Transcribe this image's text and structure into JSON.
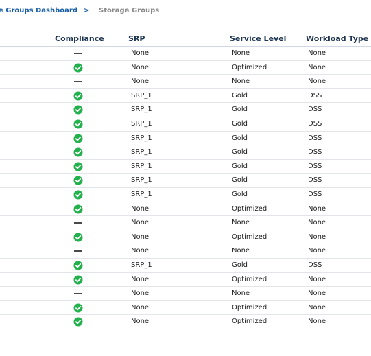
{
  "breadcrumb": {
    "parent_label": "Storage Groups Dashboard",
    "separator": ">",
    "current_label": "Storage Groups"
  },
  "table": {
    "headers": {
      "compliance": "Compliance",
      "srp": "SRP",
      "service_level": "Service Level",
      "workload_type": "Workload Type"
    },
    "rows": [
      {
        "compliance": "none",
        "srp": "None",
        "service_level": "None",
        "workload_type": "None"
      },
      {
        "compliance": "compliant",
        "srp": "None",
        "service_level": "Optimized",
        "workload_type": "None"
      },
      {
        "compliance": "none",
        "srp": "None",
        "service_level": "None",
        "workload_type": "None"
      },
      {
        "compliance": "compliant",
        "srp": "SRP_1",
        "service_level": "Gold",
        "workload_type": "DSS"
      },
      {
        "compliance": "compliant",
        "srp": "SRP_1",
        "service_level": "Gold",
        "workload_type": "DSS"
      },
      {
        "compliance": "compliant",
        "srp": "SRP_1",
        "service_level": "Gold",
        "workload_type": "DSS"
      },
      {
        "compliance": "compliant",
        "srp": "SRP_1",
        "service_level": "Gold",
        "workload_type": "DSS"
      },
      {
        "compliance": "compliant",
        "srp": "SRP_1",
        "service_level": "Gold",
        "workload_type": "DSS"
      },
      {
        "compliance": "compliant",
        "srp": "SRP_1",
        "service_level": "Gold",
        "workload_type": "DSS"
      },
      {
        "compliance": "compliant",
        "srp": "SRP_1",
        "service_level": "Gold",
        "workload_type": "DSS"
      },
      {
        "compliance": "compliant",
        "srp": "SRP_1",
        "service_level": "Gold",
        "workload_type": "DSS"
      },
      {
        "compliance": "compliant",
        "srp": "None",
        "service_level": "Optimized",
        "workload_type": "None"
      },
      {
        "compliance": "none",
        "srp": "None",
        "service_level": "None",
        "workload_type": "None"
      },
      {
        "compliance": "compliant",
        "srp": "None",
        "service_level": "Optimized",
        "workload_type": "None"
      },
      {
        "compliance": "none",
        "srp": "None",
        "service_level": "None",
        "workload_type": "None"
      },
      {
        "compliance": "compliant",
        "srp": "SRP_1",
        "service_level": "Gold",
        "workload_type": "DSS"
      },
      {
        "compliance": "compliant",
        "srp": "None",
        "service_level": "Optimized",
        "workload_type": "None"
      },
      {
        "compliance": "none",
        "srp": "None",
        "service_level": "None",
        "workload_type": "None"
      },
      {
        "compliance": "compliant",
        "srp": "None",
        "service_level": "Optimized",
        "workload_type": "None"
      },
      {
        "compliance": "compliant",
        "srp": "None",
        "service_level": "Optimized",
        "workload_type": "None"
      }
    ]
  },
  "colors": {
    "link": "#1a5fa8",
    "compliant_green": "#22b14c",
    "header_text": "#1d3550"
  },
  "icons": {
    "compliant": "check-circle-icon",
    "none": "dash-icon"
  }
}
